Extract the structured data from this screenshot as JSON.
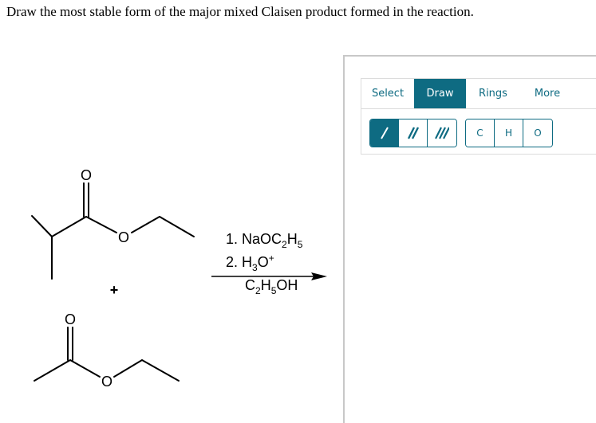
{
  "question": "Draw the most stable form of the major mixed Claisen product formed in the reaction.",
  "scheme": {
    "reactant1": {
      "name": "ethyl 2-methylpropanoate",
      "carbonyl_O": "O",
      "ester_O": "O"
    },
    "plus": "+",
    "reactant2": {
      "name": "ethyl acetate",
      "carbonyl_O": "O",
      "ester_O": "O"
    },
    "conditions": {
      "step1_prefix": "1. NaOC",
      "step1_sub1": "2",
      "step1_mid": "H",
      "step1_sub2": "5",
      "step2_prefix": "2. H",
      "step2_sub": "3",
      "step2_mid": "O",
      "step2_sup": "+",
      "solvent_a": "C",
      "solvent_sub1": "2",
      "solvent_b": "H",
      "solvent_sub2": "5",
      "solvent_c": "OH"
    }
  },
  "editor": {
    "tabs": [
      {
        "label": "Select",
        "active": false
      },
      {
        "label": "Draw",
        "active": true
      },
      {
        "label": "Rings",
        "active": false
      },
      {
        "label": "More",
        "active": false
      }
    ],
    "bond_tools": [
      {
        "icon": "single-bond-icon",
        "active": true
      },
      {
        "icon": "double-bond-icon",
        "active": false
      },
      {
        "icon": "triple-bond-icon",
        "active": false
      }
    ],
    "atom_tools": [
      {
        "label": "C"
      },
      {
        "label": "H"
      },
      {
        "label": "O"
      }
    ],
    "colors": {
      "accent": "#0e6b82",
      "border": "#dcdcdc",
      "frame": "#c8c8c8"
    }
  }
}
